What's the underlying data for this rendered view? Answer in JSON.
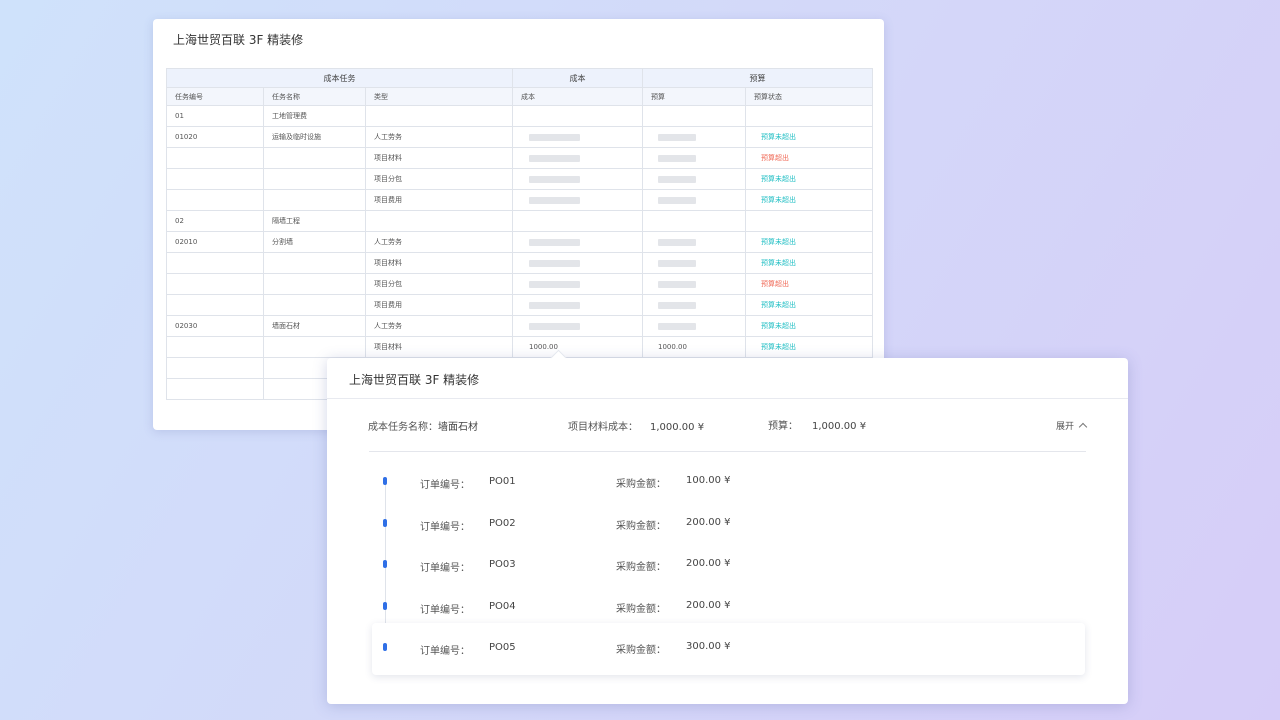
{
  "back_card": {
    "title": "上海世贸百联 3F 精装修",
    "group_headers": [
      "成本任务",
      "成本",
      "预算"
    ],
    "columns": [
      "任务编号",
      "任务名称",
      "类型",
      "成本",
      "预算",
      "预算状态"
    ],
    "rows": [
      {
        "code": "01",
        "name": "工地管理费",
        "type": "",
        "cost": "",
        "budget": "",
        "status": "",
        "status_kind": "",
        "bar": false
      },
      {
        "code": "01020",
        "name": "运输及临时设施",
        "type": "人工劳务",
        "cost": "",
        "budget": "",
        "status": "预算未超出",
        "status_kind": "ok",
        "bar": true
      },
      {
        "code": "",
        "name": "",
        "type": "项目材料",
        "cost": "",
        "budget": "",
        "status": "预算超出",
        "status_kind": "over",
        "bar": true
      },
      {
        "code": "",
        "name": "",
        "type": "项目分包",
        "cost": "",
        "budget": "",
        "status": "预算未超出",
        "status_kind": "ok",
        "bar": true
      },
      {
        "code": "",
        "name": "",
        "type": "项目费用",
        "cost": "",
        "budget": "",
        "status": "预算未超出",
        "status_kind": "ok",
        "bar": true
      },
      {
        "code": "02",
        "name": "隔墙工程",
        "type": "",
        "cost": "",
        "budget": "",
        "status": "",
        "status_kind": "",
        "bar": false
      },
      {
        "code": "02010",
        "name": "分割墙",
        "type": "人工劳务",
        "cost": "",
        "budget": "",
        "status": "预算未超出",
        "status_kind": "ok",
        "bar": true
      },
      {
        "code": "",
        "name": "",
        "type": "项目材料",
        "cost": "",
        "budget": "",
        "status": "预算未超出",
        "status_kind": "ok",
        "bar": true
      },
      {
        "code": "",
        "name": "",
        "type": "项目分包",
        "cost": "",
        "budget": "",
        "status": "预算超出",
        "status_kind": "over",
        "bar": true
      },
      {
        "code": "",
        "name": "",
        "type": "项目费用",
        "cost": "",
        "budget": "",
        "status": "预算未超出",
        "status_kind": "ok",
        "bar": true
      },
      {
        "code": "02030",
        "name": "墙面石材",
        "type": "人工劳务",
        "cost": "",
        "budget": "",
        "status": "预算未超出",
        "status_kind": "ok",
        "bar": true
      },
      {
        "code": "",
        "name": "",
        "type": "项目材料",
        "cost": "1000.00",
        "budget": "1000.00",
        "status": "预算未超出",
        "status_kind": "ok",
        "bar": false
      },
      {
        "code": "",
        "name": "",
        "type": "",
        "cost": "",
        "budget": "",
        "status": "",
        "status_kind": "",
        "bar": false
      },
      {
        "code": "",
        "name": "",
        "type": "",
        "cost": "",
        "budget": "",
        "status": "",
        "status_kind": "",
        "bar": false
      }
    ]
  },
  "detail_card": {
    "title": "上海世贸百联 3F 精装修",
    "task_label": "成本任务名称：",
    "task_value": "墙面石材",
    "material_cost_label": "项目材料成本：",
    "material_cost_value": "1,000.00 ¥",
    "budget_label": "预算：",
    "budget_value": "1,000.00 ¥",
    "expand_label": "展开",
    "order_no_label": "订单编号：",
    "amount_label": "采购金额：",
    "orders": [
      {
        "no": "PO01",
        "amount": "100.00 ¥"
      },
      {
        "no": "PO02",
        "amount": "200.00 ¥"
      },
      {
        "no": "PO03",
        "amount": "200.00 ¥"
      },
      {
        "no": "PO04",
        "amount": "200.00 ¥"
      },
      {
        "no": "PO05",
        "amount": "300.00 ¥"
      }
    ],
    "active_order_index": 4,
    "accent_color": "#2f6fe6",
    "status_colors": {
      "ok": "#21bfc4",
      "over": "#f06a57"
    }
  }
}
